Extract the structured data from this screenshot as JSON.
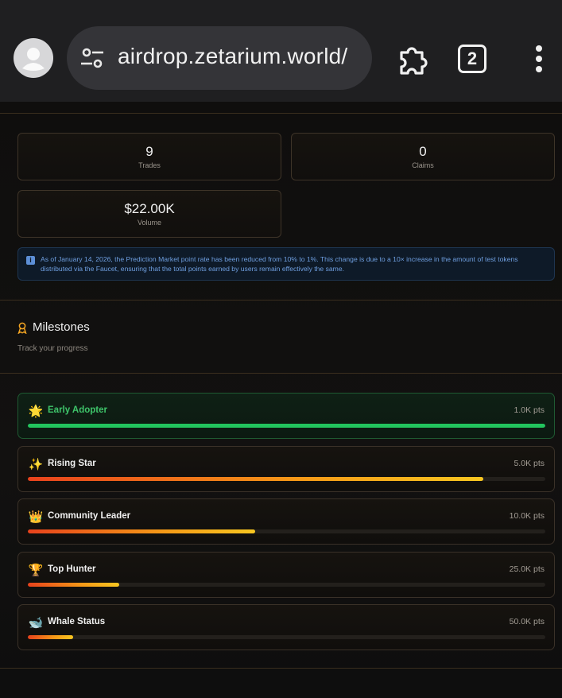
{
  "browser": {
    "url": "airdrop.zetarium.world/",
    "tab_count": "2"
  },
  "stats": {
    "trades": {
      "value": "9",
      "label": "Trades"
    },
    "claims": {
      "value": "0",
      "label": "Claims"
    },
    "volume": {
      "value": "$22.00K",
      "label": "Volume"
    }
  },
  "notice": {
    "icon": "info-icon",
    "text": "As of January 14, 2026, the Prediction Market point rate has been reduced from 10% to 1%. This change is due to a 10× increase in the amount of test tokens distributed via the Faucet, ensuring that the total points earned by users remain effectively the same."
  },
  "milestones": {
    "title": "Milestones",
    "subtitle": "Track your progress",
    "items": [
      {
        "emoji": "🌟",
        "name": "Early Adopter",
        "points": "1.0K pts",
        "progress": 1.0,
        "completed": true
      },
      {
        "emoji": "✨",
        "name": "Rising Star",
        "points": "5.0K pts",
        "progress": 0.88,
        "completed": false
      },
      {
        "emoji": "👑",
        "name": "Community Leader",
        "points": "10.0K pts",
        "progress": 0.44,
        "completed": false
      },
      {
        "emoji": "🏆",
        "name": "Top Hunter",
        "points": "25.0K pts",
        "progress": 0.176,
        "completed": false
      },
      {
        "emoji": "🐋",
        "name": "Whale Status",
        "points": "50.0K pts",
        "progress": 0.088,
        "completed": false
      }
    ]
  },
  "colors": {
    "accent_green": "#22c55e",
    "accent_orange": "#f59a17",
    "info_blue": "#6f9fe0"
  }
}
